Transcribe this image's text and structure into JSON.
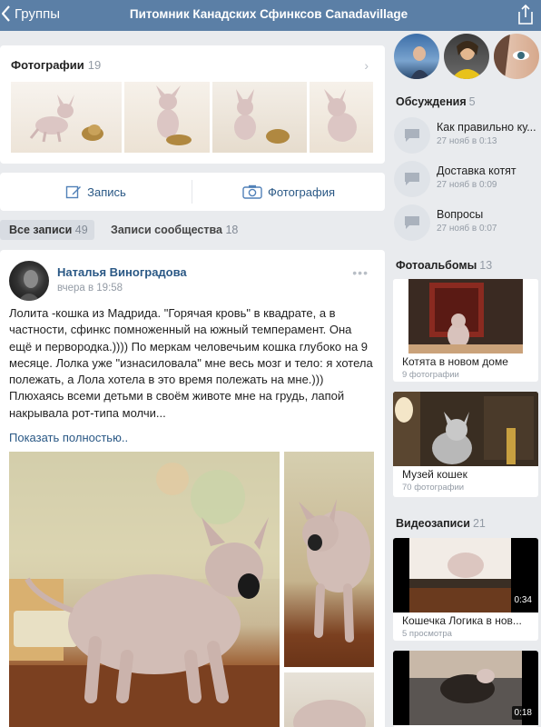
{
  "topbar": {
    "back_label": "Группы",
    "title": "Питомник Канадских Сфинксов Canadavillage"
  },
  "photos": {
    "label": "Фотографии",
    "count": "19"
  },
  "actions": {
    "post_label": "Запись",
    "photo_label": "Фотография"
  },
  "tabs": {
    "all_label": "Все записи",
    "all_count": "49",
    "community_label": "Записи сообщества",
    "community_count": "18"
  },
  "post": {
    "author": "Наталья Виноградова",
    "time": "вчера в 19:58",
    "text": "Лолита -кошка из Мадрида. \"Горячая кровь\" в квадрате, а в частности, сфинкс помноженный на южный темперамент. Она ещё и первородка.)))) По меркам человечьим кошка глубоко на 9 месяце. Лолка уже \"изнасиловала\" мне весь мозг и тело: я хотела полежать, а Лола хотела в это время полежать на мне.))) Плюхаясь всеми детьми в своём животе мне на грудь, лапой накрывала рот-типа молчи...",
    "show_more": "Показать полностью.."
  },
  "discussions": {
    "label": "Обсуждения",
    "count": "5",
    "items": [
      {
        "title": "Как правильно ку...",
        "date": "27 нояб в 0:13"
      },
      {
        "title": "Доставка котят",
        "date": "27 нояб в 0:09"
      },
      {
        "title": "Вопросы",
        "date": "27 нояб в 0:07"
      }
    ]
  },
  "albums": {
    "label": "Фотоальбомы",
    "count": "13",
    "items": [
      {
        "title": "Котята в новом доме",
        "sub": "9 фотографии"
      },
      {
        "title": "Музей кошек",
        "sub": "70 фотографии"
      }
    ]
  },
  "videos": {
    "label": "Видеозаписи",
    "count": "21",
    "items": [
      {
        "title": "Кошечка Логика в нов...",
        "sub": "5 просмотра",
        "duration": "0:34"
      },
      {
        "title": "",
        "sub": "",
        "duration": "0:18"
      }
    ]
  },
  "icons": {
    "back": "chevron-left-icon",
    "share": "share-icon",
    "post": "pencil-icon",
    "photo": "camera-icon",
    "discussion": "speech-bubble-icon",
    "more": "ellipsis-icon",
    "photos_chevron": "chevron-right-icon"
  },
  "colors": {
    "header": "#5b7fa6",
    "link": "#2a5885",
    "background": "#e9ebee"
  }
}
